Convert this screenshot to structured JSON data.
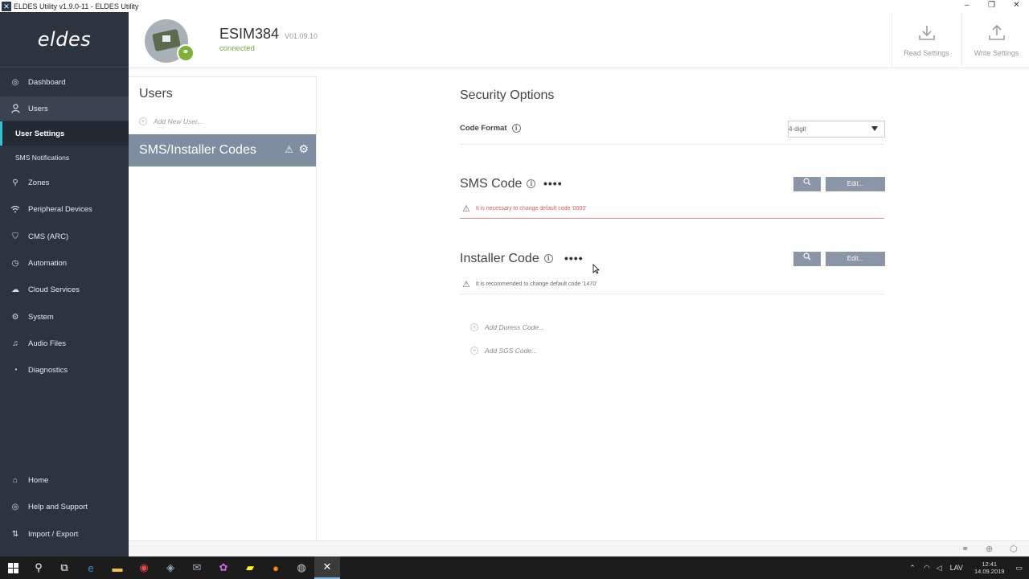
{
  "window": {
    "title": "ELDES Utility v1.9.0-11 - ELDES Utility",
    "app_icon": "✕",
    "controls": [
      "–",
      "❐",
      "✕"
    ]
  },
  "sidebar": {
    "logo": "eldes",
    "items": [
      {
        "label": "Dashboard",
        "icon": "dashboard-icon"
      },
      {
        "label": "Users",
        "icon": "user-icon"
      },
      {
        "label": "User Settings"
      },
      {
        "label": "SMS Notifications"
      },
      {
        "label": "Zones",
        "icon": "location-pin-icon"
      },
      {
        "label": "Peripheral Devices",
        "icon": "wifi-icon"
      },
      {
        "label": "CMS (ARC)",
        "icon": "shield-icon"
      },
      {
        "label": "Automation",
        "icon": "clock-icon"
      },
      {
        "label": "Cloud Services",
        "icon": "cloud-icon"
      },
      {
        "label": "System",
        "icon": "gear-icon"
      },
      {
        "label": "Audio Files",
        "icon": "music-icon"
      },
      {
        "label": "Diagnostics",
        "icon": "pulse-icon"
      },
      {
        "label": "Home",
        "icon": "home-icon"
      },
      {
        "label": "Help and Support",
        "icon": "help-icon"
      },
      {
        "label": "Import / Export",
        "icon": "import-export-icon"
      }
    ]
  },
  "header": {
    "device_name": "ESIM384",
    "version": "V01.09.10",
    "status": "connected",
    "read_settings": "Read Settings",
    "write_settings": "Write Settings"
  },
  "users_panel": {
    "title": "Users",
    "add_user": "Add New User...",
    "selected_item": "SMS/Installer Codes"
  },
  "main": {
    "security_title": "Security Options",
    "code_format_label": "Code Format",
    "code_format_value": "4-digit",
    "sms_code": {
      "title": "SMS Code",
      "masked": "••••",
      "edit": "Edit...",
      "warning": "It is necessary to change default code '0000'",
      "warning_color": "#e05a5a"
    },
    "installer_code": {
      "title": "Installer Code",
      "masked": "••••",
      "edit": "Edit...",
      "warning": "It is recommended to change default code '1470'"
    },
    "add_duress": "Add Duress Code...",
    "add_sgs": "Add SGS Code..."
  },
  "taskbar": {
    "time": "12:41",
    "date": "14.09.2019",
    "lang": "LAV"
  },
  "colors": {
    "sidebar": "#2c3440",
    "accent": "#2ec4d6",
    "connected": "#7fa635",
    "button": "#8a96a5"
  }
}
